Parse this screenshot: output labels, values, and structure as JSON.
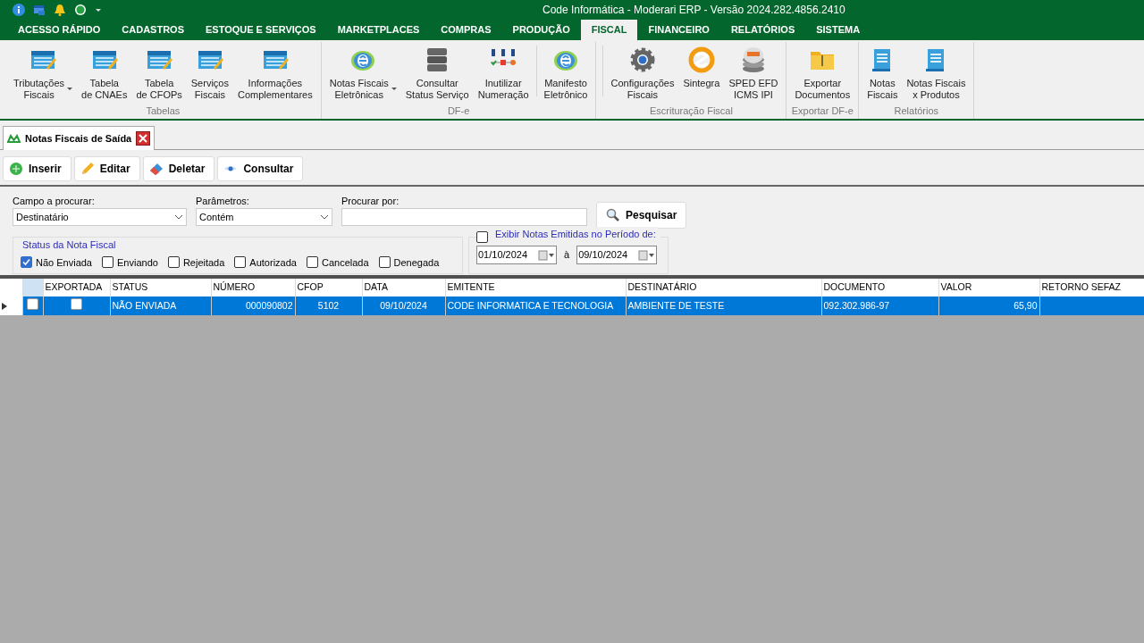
{
  "window": {
    "title": "Code Informática - Moderari ERP - Versão 2024.282.4856.2410"
  },
  "menu_tabs": [
    {
      "label": "ACESSO RÁPIDO",
      "selected": false
    },
    {
      "label": "CADASTROS",
      "selected": false
    },
    {
      "label": "ESTOQUE E SERVIÇOS",
      "selected": false
    },
    {
      "label": "MARKETPLACES",
      "selected": false
    },
    {
      "label": "COMPRAS",
      "selected": false
    },
    {
      "label": "PRODUÇÃO",
      "selected": false
    },
    {
      "label": "FISCAL",
      "selected": true
    },
    {
      "label": "FINANCEIRO",
      "selected": false
    },
    {
      "label": "RELATÓRIOS",
      "selected": false
    },
    {
      "label": "SISTEMA",
      "selected": false
    }
  ],
  "ribbon_groups": [
    {
      "caption": "Tabelas",
      "items": [
        {
          "label": "Tributações\nFiscais",
          "kind": "sheet",
          "dropdown": true
        },
        {
          "label": "Tabela\nde CNAEs",
          "kind": "sheet"
        },
        {
          "label": "Tabela\nde CFOPs",
          "kind": "sheet"
        },
        {
          "label": "Serviços\nFiscais",
          "kind": "sheet"
        },
        {
          "label": "Informações\nComplementares",
          "kind": "sheet"
        }
      ]
    },
    {
      "caption": "DF-e",
      "items": [
        {
          "label": "Notas Fiscais\nEletrônicas",
          "kind": "nfe",
          "dropdown": true
        },
        {
          "label": "Consultar\nStatus Serviço",
          "kind": "server"
        },
        {
          "label": "Inutilizar\nNumeração",
          "kind": "numbers"
        },
        {
          "label": "Manifesto\nEletrônico",
          "kind": "nfe",
          "separator_before": true
        }
      ]
    },
    {
      "caption": "Escrituração Fiscal",
      "items": [
        {
          "label": "Configurações\nFiscais",
          "kind": "gear",
          "separator_before": true
        },
        {
          "label": "Sintegra",
          "kind": "sintegra"
        },
        {
          "label": "SPED EFD\nICMS IPI",
          "kind": "sped"
        }
      ]
    },
    {
      "caption": "Exportar DF-e",
      "items": [
        {
          "label": "Exportar\nDocumentos",
          "kind": "folder"
        }
      ]
    },
    {
      "caption": "Relatórios",
      "items": [
        {
          "label": "Notas\nFiscais",
          "kind": "report"
        },
        {
          "label": "Notas Fiscais\nx Produtos",
          "kind": "report"
        }
      ]
    }
  ],
  "document_tab": {
    "label": "Notas Fiscais de Saída"
  },
  "toolbar": [
    {
      "label": "Inserir",
      "kind": "plus"
    },
    {
      "label": "Editar",
      "kind": "pencil"
    },
    {
      "label": "Deletar",
      "kind": "eraser"
    },
    {
      "label": "Consultar",
      "kind": "eye"
    }
  ],
  "filter": {
    "field_label": "Campo a procurar:",
    "field_value": "Destinatário",
    "param_label": "Parâmetros:",
    "param_value": "Contém",
    "search_label": "Procurar por:",
    "search_button": "Pesquisar",
    "status_group": "Status da Nota Fiscal",
    "statuses": [
      {
        "label": "Não Enviada",
        "checked": true
      },
      {
        "label": "Enviando",
        "checked": false
      },
      {
        "label": "Rejeitada",
        "checked": false
      },
      {
        "label": "Autorizada",
        "checked": false
      },
      {
        "label": "Cancelada",
        "checked": false
      },
      {
        "label": "Denegada",
        "checked": false
      }
    ],
    "period": {
      "label": "Exibir Notas Emitidas no Período de:",
      "checked": false,
      "from": "01/10/2024",
      "separator": "à",
      "to": "09/10/2024"
    }
  },
  "table": {
    "columns": [
      {
        "label": "EXPORTADA"
      },
      {
        "label": "STATUS"
      },
      {
        "label": "NÚMERO"
      },
      {
        "label": "CFOP"
      },
      {
        "label": "DATA"
      },
      {
        "label": "EMITENTE"
      },
      {
        "label": "DESTINATÁRIO"
      },
      {
        "label": "DOCUMENTO"
      },
      {
        "label": "VALOR"
      },
      {
        "label": "RETORNO SEFAZ"
      }
    ],
    "rows": [
      {
        "selected": true,
        "checked": false,
        "exportada": false,
        "cells": [
          "",
          "NÃO ENVIADA",
          "000090802",
          "5102",
          "09/10/2024",
          "CODE INFORMATICA E TECNOLOGIA",
          "AMBIENTE DE TESTE",
          "092.302.986-97",
          "65,90",
          ""
        ]
      }
    ]
  }
}
